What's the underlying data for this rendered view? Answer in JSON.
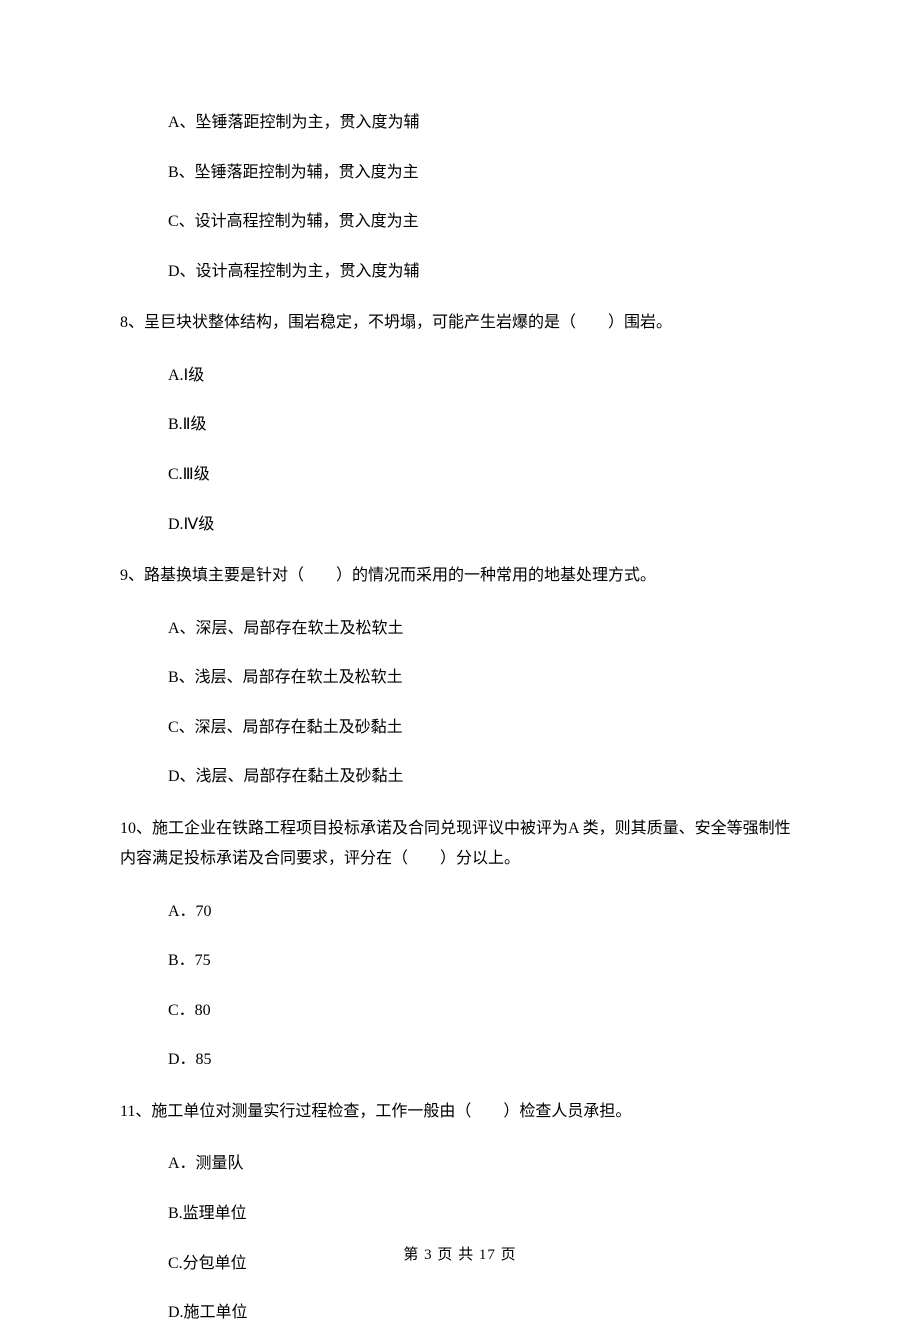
{
  "q7_options": {
    "a": "A、坠锤落距控制为主，贯入度为辅",
    "b": "B、坠锤落距控制为辅，贯入度为主",
    "c": "C、设计高程控制为辅，贯入度为主",
    "d": "D、设计高程控制为主，贯入度为辅"
  },
  "q8": {
    "text": "8、呈巨块状整体结构，围岩稳定，不坍塌，可能产生岩爆的是（　　）围岩。",
    "a": "A.Ⅰ级",
    "b": "B.Ⅱ级",
    "c": "C.Ⅲ级",
    "d": "D.Ⅳ级"
  },
  "q9": {
    "text": "9、路基换填主要是针对（　　）的情况而采用的一种常用的地基处理方式。",
    "a": "A、深层、局部存在软土及松软土",
    "b": "B、浅层、局部存在软土及松软土",
    "c": "C、深层、局部存在黏土及砂黏土",
    "d": "D、浅层、局部存在黏土及砂黏土"
  },
  "q10": {
    "text": "10、施工企业在铁路工程项目投标承诺及合同兑现评议中被评为A 类，则其质量、安全等强制性内容满足投标承诺及合同要求，评分在（　　）分以上。",
    "a": "A．70",
    "b": "B．75",
    "c": "C．80",
    "d": "D．85"
  },
  "q11": {
    "text": "11、施工单位对测量实行过程检查，工作一般由（　　）检查人员承担。",
    "a": "A．测量队",
    "b": "B.监理单位",
    "c": "C.分包单位",
    "d": "D.施工单位"
  },
  "footer": "第 3 页 共 17 页"
}
